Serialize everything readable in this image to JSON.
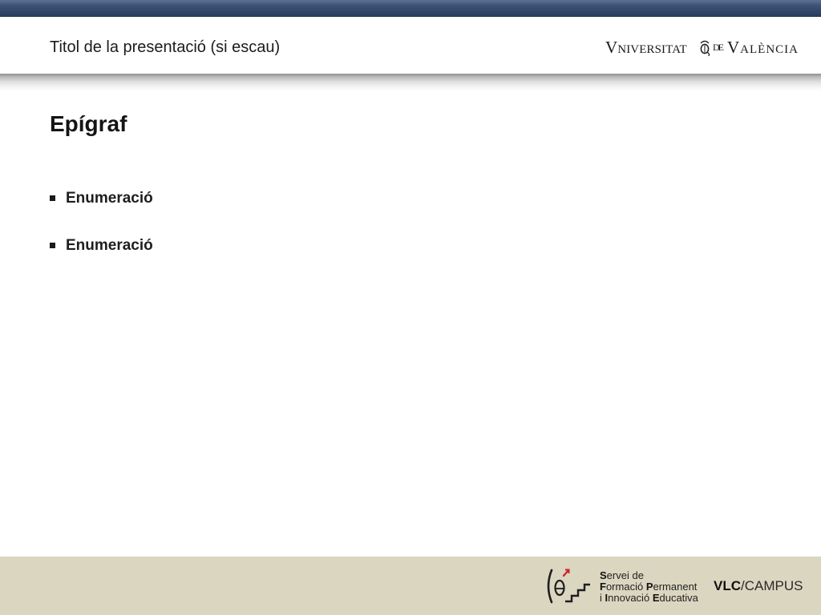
{
  "header": {
    "title": "Titol de la presentació (si escau)"
  },
  "university_logo": {
    "word1": "VNIVERSITAT",
    "emblem_icon": "university-seal-icon",
    "word2": "DE",
    "word3": "VALÈNCIA"
  },
  "content": {
    "heading": "Epígraf",
    "bullet_icon": "square-bullet-icon",
    "bullets": [
      "Enumeració",
      "Enumeració"
    ]
  },
  "footer": {
    "service_logo": {
      "icon": "staircase-person-icon",
      "lines": [
        "Servei de",
        "Formació Permanent",
        "i Innovació Educativa"
      ]
    },
    "campus_logo": "VLC/CAMPUS"
  },
  "colors": {
    "top_bar": "#3d5276",
    "footer_band": "#dad6c0",
    "accent_arrow": "#d0202a",
    "text": "#1a1a1a"
  }
}
